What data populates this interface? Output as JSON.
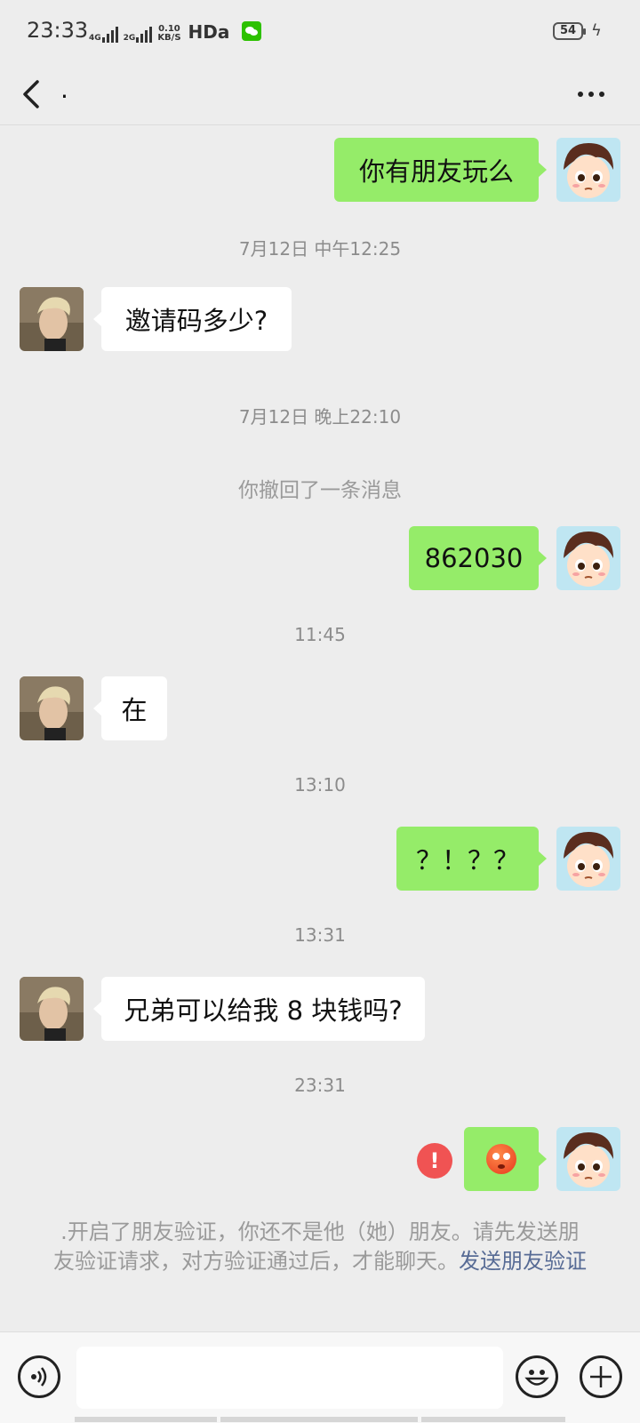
{
  "status_bar": {
    "time": "23:33",
    "net1": "4G",
    "net2": "2G",
    "speed_value": "0.10",
    "speed_unit": "KB/S",
    "hd": "HDa",
    "battery": "54"
  },
  "header": {
    "title": ".",
    "back_icon": "chevron-left-icon",
    "more_icon": "more-dots-icon"
  },
  "messages": [
    {
      "type": "me",
      "text": "你有朋友玩么"
    },
    {
      "type": "time",
      "text": "7月12日 中午12:25"
    },
    {
      "type": "other",
      "text": "邀请码多少?"
    },
    {
      "type": "time",
      "text": "7月12日 晚上22:10"
    },
    {
      "type": "system",
      "text": "你撤回了一条消息"
    },
    {
      "type": "me",
      "text": "862030"
    },
    {
      "type": "time",
      "text": "11:45"
    },
    {
      "type": "other",
      "text": "在"
    },
    {
      "type": "time",
      "text": "13:10"
    },
    {
      "type": "me",
      "text": "？！？？"
    },
    {
      "type": "time",
      "text": "13:31"
    },
    {
      "type": "other",
      "text": "兄弟可以给我 8 块钱吗?"
    },
    {
      "type": "time",
      "text": "23:31"
    },
    {
      "type": "me",
      "emoji": "flushed-emoji",
      "failed": true
    }
  ],
  "notice": {
    "text": ".开启了朋友验证，你还不是他（她）朋友。请先发送朋友验证请求，对方验证通过后，才能聊天。",
    "link": "发送朋友验证"
  },
  "input_bar": {
    "voice_icon": "voice-icon",
    "emoji_icon": "smiley-icon",
    "plus_icon": "plus-icon",
    "value": ""
  },
  "colors": {
    "background": "#ededed",
    "my_bubble": "#95ec69",
    "their_bubble": "#ffffff",
    "error": "#f05353",
    "link": "#576b95"
  }
}
